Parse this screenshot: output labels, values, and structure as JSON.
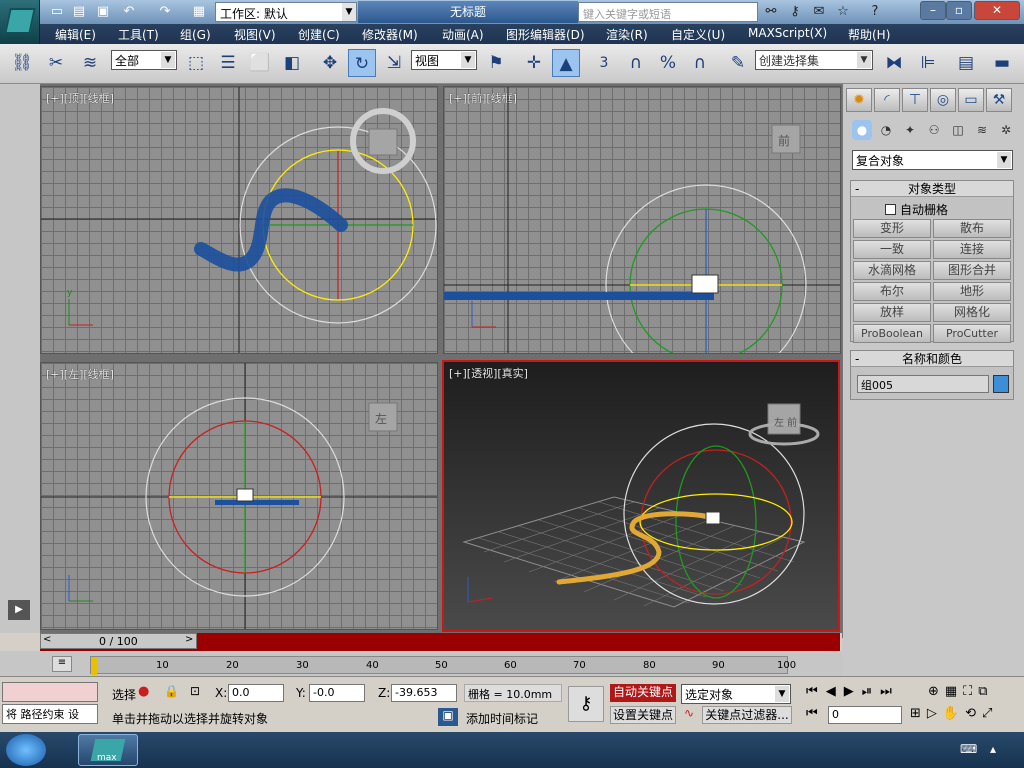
{
  "title": {
    "workspace_label": "工作区: 默认",
    "document": "无标题",
    "search_placeholder": "键入关键字或短语"
  },
  "menu": [
    "编辑(E)",
    "工具(T)",
    "组(G)",
    "视图(V)",
    "创建(C)",
    "修改器(M)",
    "动画(A)",
    "图形编辑器(D)",
    "渲染(R)",
    "自定义(U)",
    "MAXScript(X)",
    "帮助(H)"
  ],
  "toolbar": {
    "filter": "全部",
    "refcoord": "视图",
    "selset_placeholder": "创建选择集",
    "snap": "3",
    "angle_snap": "%"
  },
  "viewports": [
    {
      "label": "[+][顶][线框]"
    },
    {
      "label": "[+][前][线框]"
    },
    {
      "label": "[+][左][线框]"
    },
    {
      "label": "[+][透视][真实]"
    }
  ],
  "viewcube": {
    "top": "",
    "front": "前",
    "left": "左",
    "persp_front": "前",
    "persp_left": "左"
  },
  "panel": {
    "category": "复合对象",
    "object_type_header": "对象类型",
    "autogrid": "自动栅格",
    "buttons": [
      [
        "变形",
        "散布"
      ],
      [
        "一致",
        "连接"
      ],
      [
        "水滴网格",
        "图形合并"
      ],
      [
        "布尔",
        "地形"
      ],
      [
        "放样",
        "网格化"
      ],
      [
        "ProBoolean",
        "ProCutter"
      ]
    ],
    "name_color_header": "名称和颜色",
    "object_name": "组005",
    "object_color": "#3c8ed8"
  },
  "time": {
    "frame": "0 / 100",
    "ticks": [
      "10",
      "20",
      "30",
      "40",
      "50",
      "60",
      "70",
      "80",
      "90",
      "100"
    ]
  },
  "status": {
    "maxscript_line": "将 路径约束 设",
    "selection_label": "选择",
    "x_label": "X:",
    "x": "0.0",
    "y_label": "Y:",
    "y": "-0.0",
    "z_label": "Z:",
    "z": "-39.653",
    "grid": "栅格 = 10.0mm",
    "prompt": "单击并拖动以选择并旋转对象",
    "add_time_tag": "添加时间标记",
    "auto_key": "自动关键点",
    "set_key": "设置关键点",
    "selected": "选定对象",
    "key_filters": "关键点过滤器...",
    "frame_input": "0"
  },
  "taskbar": {
    "app_label": "max"
  },
  "colors": {
    "accent": "#9a0000",
    "active_border": "#c81818"
  }
}
